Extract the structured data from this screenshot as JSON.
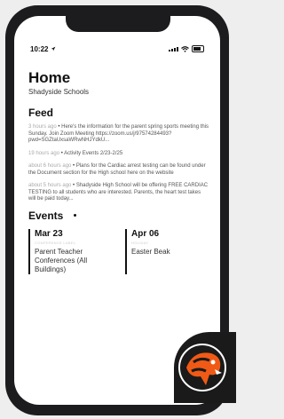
{
  "status_bar": {
    "time": "10:22"
  },
  "header": {
    "title": "Home",
    "subtitle": "Shadyside Schools"
  },
  "feed": {
    "title": "Feed",
    "items": [
      {
        "time": "3 hours ago",
        "text": "Here's the information for the parent spring sports meeting this Sunday. Join Zoom Meeting https://zoom.us/j/97574284493?pwd=SGZtaUxsaWRwNHJYdkU..."
      },
      {
        "time": "19 hours ago",
        "text": "Activity Events 2/23-2/25"
      },
      {
        "time": "about 6 hours ago",
        "text": "Plans for the Cardiac arrest testing can be found under the Document section for the High school here on the website"
      },
      {
        "time": "about 5 hours ago",
        "text": "Shadyside High School will be offering FREE CARDIAC TESTING to all students who are interested. Parents, the heart test takes will be paid today..."
      }
    ]
  },
  "events": {
    "title": "Events",
    "items": [
      {
        "date": "Mar 23",
        "category": "CONFERENCE LABEL",
        "name": "Parent Teacher Conferences (All Buildings)"
      },
      {
        "date": "Apr 06",
        "category": "HOLIDAY",
        "name": "Easter Beak"
      }
    ]
  },
  "colors": {
    "accent": "#f05a16",
    "text": "#111111",
    "phone_frame": "#1c1c1e"
  },
  "icons": [
    "location-arrow-icon",
    "signal-icon",
    "wifi-icon",
    "battery-icon",
    "school-mascot-logo"
  ]
}
